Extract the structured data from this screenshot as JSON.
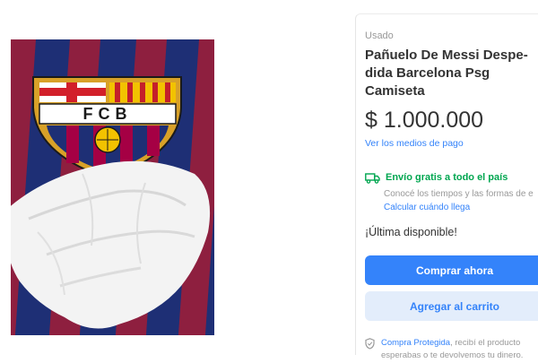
{
  "product": {
    "image_icon": "fcb-scarf-with-tissue-photo",
    "crest_text": "FCB"
  },
  "info": {
    "condition": "Usado",
    "title_lines": [
      "Pañuelo De Messi Despe-",
      "dida Barcelona Psg",
      "Camiseta"
    ],
    "price": "$ 1.000.000",
    "payment_link": "Ver los medios de pago"
  },
  "shipping": {
    "icon": "truck-icon",
    "title": "Envío gratis a todo el país",
    "note": "Conocé los tiempos y las formas de e",
    "calc_link": "Calcular cuándo llega"
  },
  "stock": "¡Última disponible!",
  "actions": {
    "buy_label": "Comprar ahora",
    "cart_label": "Agregar al carrito"
  },
  "protection": {
    "icon": "shield-icon",
    "link": "Compra Protegida",
    "line1_rest": ", recibí el producto",
    "line2": "esperabas o te devolvemos tu dinero."
  },
  "colors": {
    "accent": "#3483fa",
    "accent_light": "#e3edfb",
    "success": "#00a650",
    "muted": "#999999",
    "barca_blue": "#1e2f75",
    "barca_red": "#a50044"
  }
}
